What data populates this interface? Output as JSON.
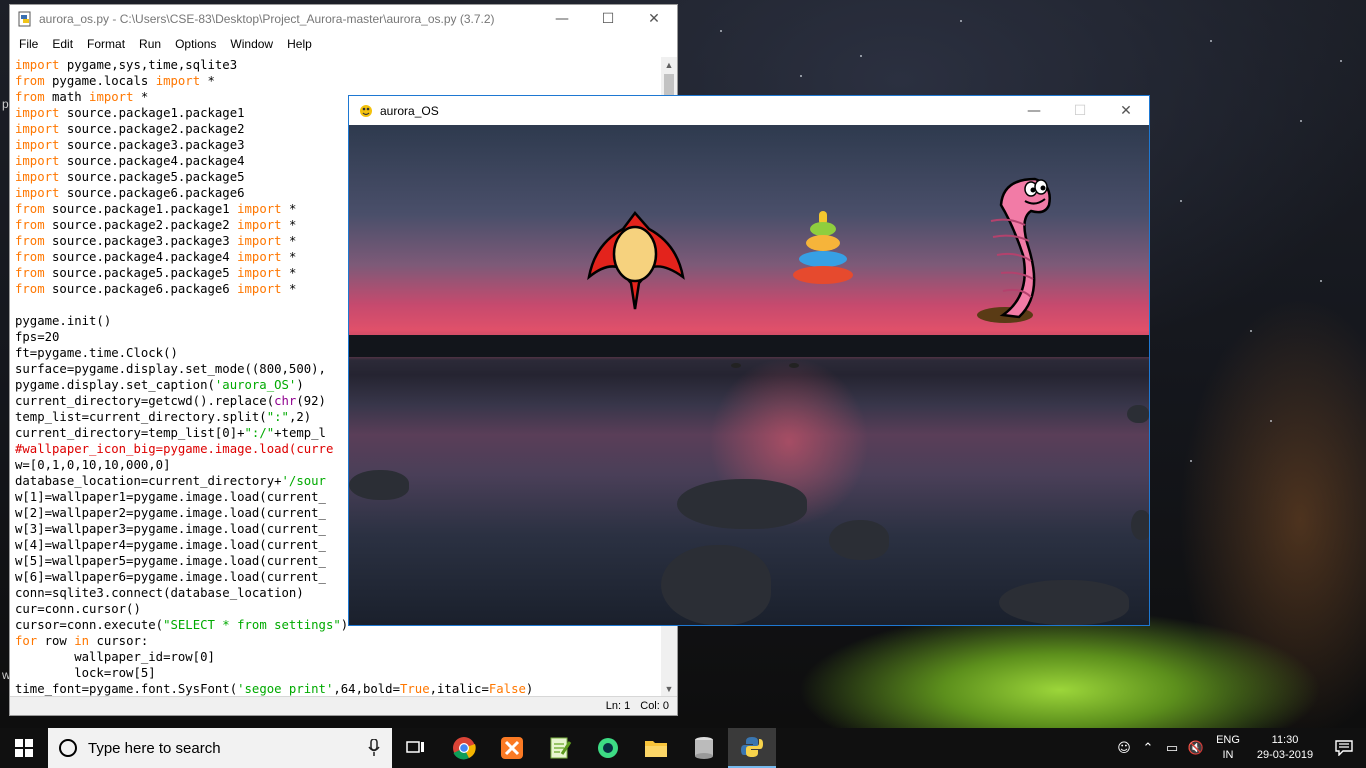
{
  "desktop": {
    "partial_letters": [
      "p",
      "w"
    ]
  },
  "idle_window": {
    "title": "aurora_os.py - C:\\Users\\CSE-83\\Desktop\\Project_Aurora-master\\aurora_os.py (3.7.2)",
    "menu": [
      "File",
      "Edit",
      "Format",
      "Run",
      "Options",
      "Window",
      "Help"
    ],
    "status": {
      "line": "Ln: 1",
      "col": "Col: 0"
    }
  },
  "code_lines": [
    [
      [
        "kw",
        "import"
      ],
      [
        "t",
        " pygame,sys,time,sqlite3"
      ]
    ],
    [
      [
        "kw",
        "from"
      ],
      [
        "t",
        " pygame.locals "
      ],
      [
        "kw",
        "import"
      ],
      [
        "t",
        " *"
      ]
    ],
    [
      [
        "kw",
        "from"
      ],
      [
        "t",
        " math "
      ],
      [
        "kw",
        "import"
      ],
      [
        "t",
        " *"
      ]
    ],
    [
      [
        "kw",
        "import"
      ],
      [
        "t",
        " source.package1.package1"
      ]
    ],
    [
      [
        "kw",
        "import"
      ],
      [
        "t",
        " source.package2.package2"
      ]
    ],
    [
      [
        "kw",
        "import"
      ],
      [
        "t",
        " source.package3.package3"
      ]
    ],
    [
      [
        "kw",
        "import"
      ],
      [
        "t",
        " source.package4.package4"
      ]
    ],
    [
      [
        "kw",
        "import"
      ],
      [
        "t",
        " source.package5.package5"
      ]
    ],
    [
      [
        "kw",
        "import"
      ],
      [
        "t",
        " source.package6.package6"
      ]
    ],
    [
      [
        "kw",
        "from"
      ],
      [
        "t",
        " source.package1.package1 "
      ],
      [
        "kw",
        "import"
      ],
      [
        "t",
        " *"
      ]
    ],
    [
      [
        "kw",
        "from"
      ],
      [
        "t",
        " source.package2.package2 "
      ],
      [
        "kw",
        "import"
      ],
      [
        "t",
        " *"
      ]
    ],
    [
      [
        "kw",
        "from"
      ],
      [
        "t",
        " source.package3.package3 "
      ],
      [
        "kw",
        "import"
      ],
      [
        "t",
        " *"
      ]
    ],
    [
      [
        "kw",
        "from"
      ],
      [
        "t",
        " source.package4.package4 "
      ],
      [
        "kw",
        "import"
      ],
      [
        "t",
        " *"
      ]
    ],
    [
      [
        "kw",
        "from"
      ],
      [
        "t",
        " source.package5.package5 "
      ],
      [
        "kw",
        "import"
      ],
      [
        "t",
        " *"
      ]
    ],
    [
      [
        "kw",
        "from"
      ],
      [
        "t",
        " source.package6.package6 "
      ],
      [
        "kw",
        "import"
      ],
      [
        "t",
        " *"
      ]
    ],
    [
      [
        "t",
        ""
      ]
    ],
    [
      [
        "t",
        "pygame.init()"
      ]
    ],
    [
      [
        "t",
        "fps=20"
      ]
    ],
    [
      [
        "t",
        "ft=pygame.time.Clock()"
      ]
    ],
    [
      [
        "t",
        "surface=pygame.display.set_mode((800,500),"
      ]
    ],
    [
      [
        "t",
        "pygame.display.set_caption("
      ],
      [
        "str",
        "'aurora_OS'"
      ],
      [
        "t",
        ")"
      ]
    ],
    [
      [
        "t",
        "current_directory=getcwd().replace("
      ],
      [
        "bi",
        "chr"
      ],
      [
        "t",
        "(92)"
      ]
    ],
    [
      [
        "t",
        "temp_list=current_directory.split("
      ],
      [
        "str",
        "\":\""
      ],
      [
        "t",
        ",2)"
      ]
    ],
    [
      [
        "t",
        "current_directory=temp_list[0]+"
      ],
      [
        "str",
        "\":/\""
      ],
      [
        "t",
        "+temp_l"
      ]
    ],
    [
      [
        "cmt",
        "#wallpaper_icon_big=pygame.image.load(curre"
      ]
    ],
    [
      [
        "t",
        "w=[0,1,0,10,10,000,0]"
      ]
    ],
    [
      [
        "t",
        "database_location=current_directory+"
      ],
      [
        "str",
        "'/sour"
      ]
    ],
    [
      [
        "t",
        "w[1]=wallpaper1=pygame.image.load(current_"
      ]
    ],
    [
      [
        "t",
        "w[2]=wallpaper2=pygame.image.load(current_"
      ]
    ],
    [
      [
        "t",
        "w[3]=wallpaper3=pygame.image.load(current_"
      ]
    ],
    [
      [
        "t",
        "w[4]=wallpaper4=pygame.image.load(current_"
      ]
    ],
    [
      [
        "t",
        "w[5]=wallpaper5=pygame.image.load(current_"
      ]
    ],
    [
      [
        "t",
        "w[6]=wallpaper6=pygame.image.load(current_"
      ]
    ],
    [
      [
        "t",
        "conn=sqlite3.connect(database_location)"
      ]
    ],
    [
      [
        "t",
        "cur=conn.cursor()"
      ]
    ],
    [
      [
        "t",
        "cursor=conn.execute("
      ],
      [
        "str",
        "\"SELECT * from settings\""
      ],
      [
        "t",
        ")"
      ]
    ],
    [
      [
        "kw",
        "for"
      ],
      [
        "t",
        " row "
      ],
      [
        "kw",
        "in"
      ],
      [
        "t",
        " cursor:"
      ]
    ],
    [
      [
        "t",
        "        wallpaper_id=row[0]"
      ]
    ],
    [
      [
        "t",
        "        lock=row[5]"
      ]
    ],
    [
      [
        "t",
        "time_font=pygame.font.SysFont("
      ],
      [
        "str",
        "'segoe print'"
      ],
      [
        "t",
        ",64,bold="
      ],
      [
        "kw",
        "True"
      ],
      [
        "t",
        ",italic="
      ],
      [
        "kw",
        "False"
      ],
      [
        "t",
        ")"
      ]
    ]
  ],
  "pygame_window": {
    "title": "aurora_OS",
    "icons": [
      "rocket-icon",
      "ring-stack-toy-icon",
      "worm-icon"
    ]
  },
  "taskbar": {
    "search_placeholder": "Type here to search",
    "apps": [
      "task-view",
      "chrome",
      "xampp",
      "notepad-plus-plus",
      "android-studio",
      "file-explorer",
      "database",
      "python-idle"
    ],
    "language_top": "ENG",
    "language_bottom": "IN",
    "time": "11:30",
    "date": "29-03-2019"
  },
  "colors": {
    "keyword": "#ff7700",
    "string": "#00aa00",
    "comment": "#dd0000",
    "builtin": "#900090",
    "accent_border": "#1e78d2"
  }
}
